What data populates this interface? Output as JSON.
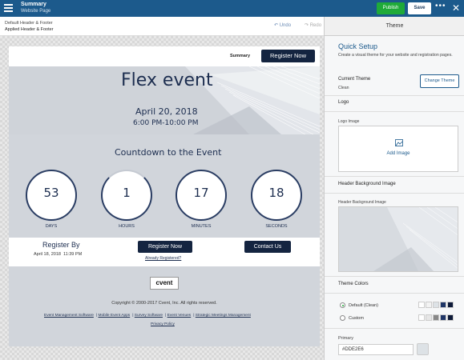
{
  "topbar": {
    "title": "Summary",
    "subtitle": "Website Page",
    "publish": "Publish",
    "save": "Save",
    "more": "•••",
    "close": "✕"
  },
  "subbar": {
    "line1": "Default Header & Footer",
    "line2": "Applied Header & Footer",
    "undo": "↶ Undo",
    "redo": "↷ Redo"
  },
  "page": {
    "header": {
      "summary": "Summary",
      "register": "Register Now"
    },
    "event": {
      "title": "Flex event",
      "date": "April 20, 2018",
      "time": "6:00 PM-10:00 PM"
    },
    "countdown": {
      "title": "Countdown to the Event",
      "items": [
        {
          "value": "53",
          "label": "DAYS",
          "fraction": 1
        },
        {
          "value": "1",
          "label": "HOURS",
          "fraction": 0.04
        },
        {
          "value": "17",
          "label": "MINUTES",
          "fraction": 0.28
        },
        {
          "value": "18",
          "label": "SECONDS",
          "fraction": 0.3
        }
      ]
    },
    "register": {
      "title": "Register By",
      "date": "April 18, 2018",
      "time": "11:39 PM",
      "button": "Register Now",
      "already": "Already Registered?",
      "contact": "Contact Us"
    },
    "footer": {
      "logo": "cvent",
      "copyright": "Copyright © 2000-2017 Cvent, Inc. All rights reserved.",
      "links": [
        "Event Management Software",
        "Mobile Event Apps",
        "Survey Software",
        "Event Venues",
        "Strategic Meetings Management"
      ],
      "privacy": "Privacy Policy"
    }
  },
  "panel": {
    "header": "Theme",
    "quick_title": "Quick Setup",
    "quick_desc": "Create a visual theme for your website and registration pages.",
    "current_theme_label": "Current Theme",
    "current_theme_value": "Clean",
    "change_button": "Change Theme",
    "logo_section": "Logo",
    "logo_image_label": "Logo Image",
    "add_image": "Add Image",
    "header_bg_section": "Header Background Image",
    "header_bg_label": "Header Background Image",
    "theme_colors_section": "Theme Colors",
    "default_option": "Default (Clean)",
    "custom_option": "Custom",
    "default_swatches": [
      "#ffffff",
      "#f3f3f3",
      "#dde2e6",
      "#1f3566",
      "#0e1a38"
    ],
    "custom_swatches": [
      "#ffffff",
      "#e6e6e6",
      "#888888",
      "#1f3566",
      "#0e1a38"
    ],
    "primary_label": "Primary",
    "primary_value": "#DDE2E6"
  }
}
